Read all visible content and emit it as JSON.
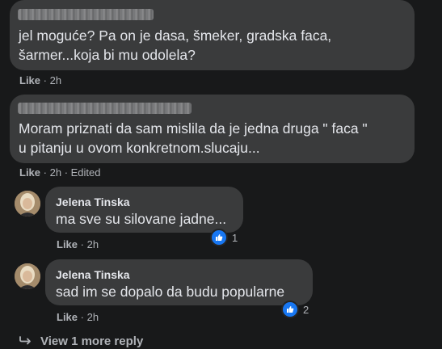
{
  "comments": [
    {
      "author_redacted": true,
      "lines": [
        "jel moguće? Pa on je dasa, šmeker, gradska faca,",
        "šarmer...koja bi mu odolela?"
      ],
      "like_label": "Like",
      "time": "2h"
    },
    {
      "author_redacted": true,
      "lines": [
        "Moram priznati da sam mislila da je jedna druga \" faca \"",
        "u pitanju u ovom konkretnom.slucaju..."
      ],
      "like_label": "Like",
      "time": "2h",
      "edited_label": "Edited"
    }
  ],
  "replies": [
    {
      "author": "Jelena Tinska",
      "text": "ma sve su silovane jadne...",
      "like_label": "Like",
      "time": "2h",
      "reaction_icon": "thumbs-up-icon",
      "reaction_count": "1"
    },
    {
      "author": "Jelena Tinska",
      "text": "sad im se dopalo da budu popularne",
      "like_label": "Like",
      "time": "2h",
      "reaction_icon": "thumbs-up-icon",
      "reaction_count": "2"
    }
  ],
  "more_replies": {
    "icon": "reply-arrow-icon",
    "label": "View 1 more reply"
  },
  "colors": {
    "background": "#18191a",
    "bubble": "#3a3b3c",
    "text": "#e4e6eb",
    "secondary_text": "#b0b3b8",
    "like_blue": "#1877f2"
  }
}
